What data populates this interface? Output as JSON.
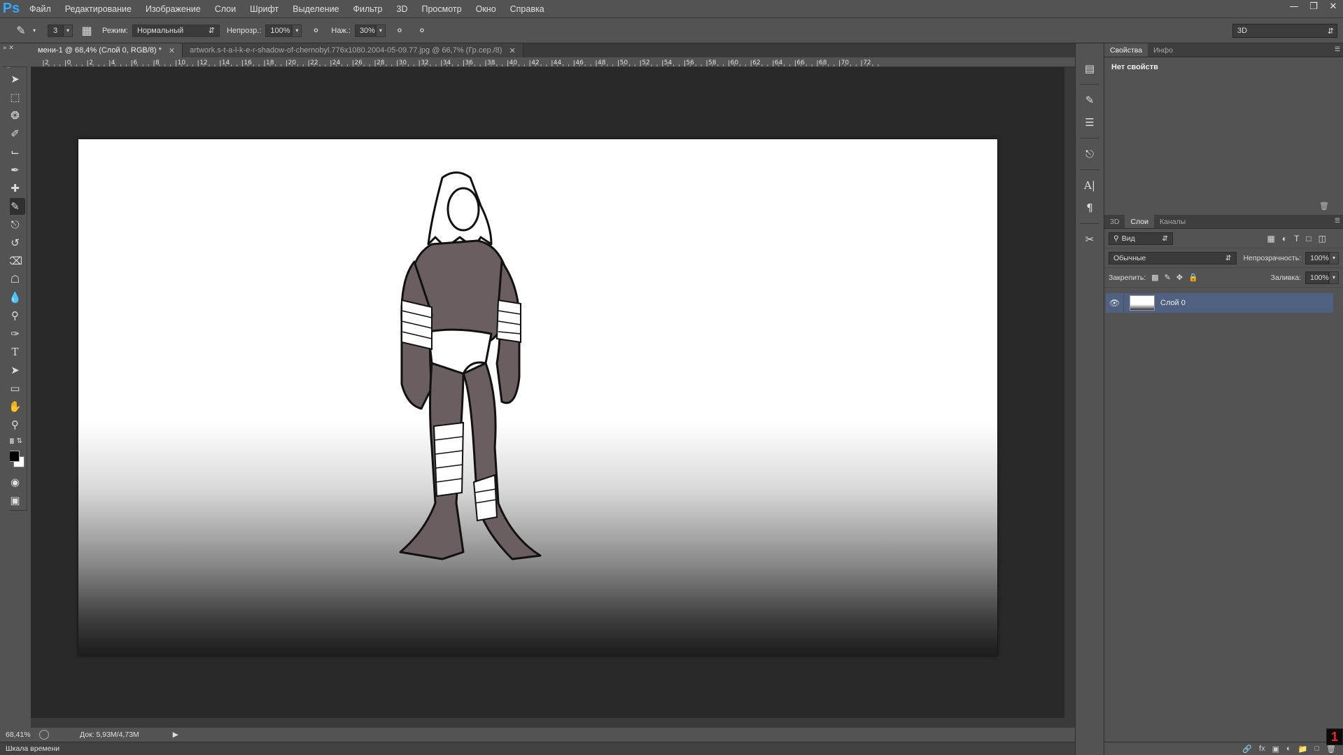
{
  "app": {
    "logo": "Ps"
  },
  "menu": [
    "Файл",
    "Редактирование",
    "Изображение",
    "Слои",
    "Шрифт",
    "Выделение",
    "Фильтр",
    "3D",
    "Просмотр",
    "Окно",
    "Справка"
  ],
  "options": {
    "brush_size": "3",
    "mode_label": "Режим:",
    "mode_value": "Нормальный",
    "opacity_label": "Непрозр.:",
    "opacity_value": "100%",
    "pressure_label": "Наж.:",
    "pressure_value": "30%",
    "workspace": "3D"
  },
  "tabs": [
    {
      "label": "мени-1 @ 68,4% (Слой 0, RGB/8) *",
      "active": true
    },
    {
      "label": "artwork.s-t-a-l-k-e-r-shadow-of-chernobyl.776x1080.2004-05-09.77.jpg @ 66,7% (Гр.сер./8)",
      "active": false
    }
  ],
  "ruler": {
    "top_ticks": [
      "2",
      "0",
      "2",
      "4",
      "6",
      "8",
      "10",
      "12",
      "14",
      "16",
      "18",
      "20",
      "22",
      "24",
      "26",
      "28",
      "30",
      "32",
      "34",
      "36",
      "38",
      "40",
      "42",
      "44",
      "46",
      "48",
      "50",
      "52",
      "54",
      "56",
      "58",
      "60",
      "62",
      "64",
      "66",
      "68",
      "70",
      "72"
    ]
  },
  "status": {
    "zoom": "68,41%",
    "doc_info": "Док: 5,93M/4,73M",
    "timeline": "Шкала времени"
  },
  "properties": {
    "tabs": [
      "Свойства",
      "Инфо"
    ],
    "empty_text": "Нет свойств"
  },
  "layers": {
    "tabs": [
      "3D",
      "Слои",
      "Каналы"
    ],
    "filter": "Вид",
    "blend_mode": "Обычные",
    "opacity_label": "Непрозрачность:",
    "opacity_value": "100%",
    "lock_label": "Закрепить:",
    "fill_label": "Заливка:",
    "fill_value": "100%",
    "items": [
      {
        "name": "Слой 0",
        "visible": true,
        "selected": true
      }
    ]
  },
  "badge": "1",
  "colors": {
    "accent": "#31a8ff",
    "panel": "#535353",
    "canvas_bg": "#282828",
    "layer_selected": "#4f6080"
  }
}
